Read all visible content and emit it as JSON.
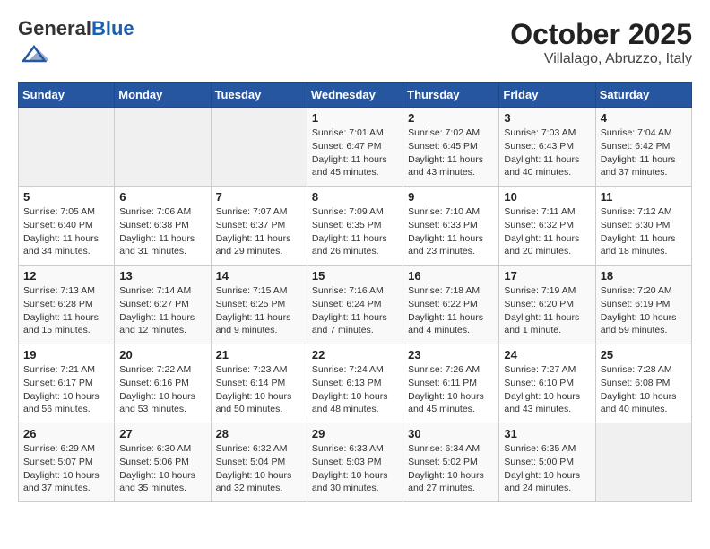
{
  "header": {
    "logo_general": "General",
    "logo_blue": "Blue",
    "month": "October 2025",
    "location": "Villalago, Abruzzo, Italy"
  },
  "weekdays": [
    "Sunday",
    "Monday",
    "Tuesday",
    "Wednesday",
    "Thursday",
    "Friday",
    "Saturday"
  ],
  "weeks": [
    [
      {
        "day": "",
        "info": ""
      },
      {
        "day": "",
        "info": ""
      },
      {
        "day": "",
        "info": ""
      },
      {
        "day": "1",
        "info": "Sunrise: 7:01 AM\nSunset: 6:47 PM\nDaylight: 11 hours and 45 minutes."
      },
      {
        "day": "2",
        "info": "Sunrise: 7:02 AM\nSunset: 6:45 PM\nDaylight: 11 hours and 43 minutes."
      },
      {
        "day": "3",
        "info": "Sunrise: 7:03 AM\nSunset: 6:43 PM\nDaylight: 11 hours and 40 minutes."
      },
      {
        "day": "4",
        "info": "Sunrise: 7:04 AM\nSunset: 6:42 PM\nDaylight: 11 hours and 37 minutes."
      }
    ],
    [
      {
        "day": "5",
        "info": "Sunrise: 7:05 AM\nSunset: 6:40 PM\nDaylight: 11 hours and 34 minutes."
      },
      {
        "day": "6",
        "info": "Sunrise: 7:06 AM\nSunset: 6:38 PM\nDaylight: 11 hours and 31 minutes."
      },
      {
        "day": "7",
        "info": "Sunrise: 7:07 AM\nSunset: 6:37 PM\nDaylight: 11 hours and 29 minutes."
      },
      {
        "day": "8",
        "info": "Sunrise: 7:09 AM\nSunset: 6:35 PM\nDaylight: 11 hours and 26 minutes."
      },
      {
        "day": "9",
        "info": "Sunrise: 7:10 AM\nSunset: 6:33 PM\nDaylight: 11 hours and 23 minutes."
      },
      {
        "day": "10",
        "info": "Sunrise: 7:11 AM\nSunset: 6:32 PM\nDaylight: 11 hours and 20 minutes."
      },
      {
        "day": "11",
        "info": "Sunrise: 7:12 AM\nSunset: 6:30 PM\nDaylight: 11 hours and 18 minutes."
      }
    ],
    [
      {
        "day": "12",
        "info": "Sunrise: 7:13 AM\nSunset: 6:28 PM\nDaylight: 11 hours and 15 minutes."
      },
      {
        "day": "13",
        "info": "Sunrise: 7:14 AM\nSunset: 6:27 PM\nDaylight: 11 hours and 12 minutes."
      },
      {
        "day": "14",
        "info": "Sunrise: 7:15 AM\nSunset: 6:25 PM\nDaylight: 11 hours and 9 minutes."
      },
      {
        "day": "15",
        "info": "Sunrise: 7:16 AM\nSunset: 6:24 PM\nDaylight: 11 hours and 7 minutes."
      },
      {
        "day": "16",
        "info": "Sunrise: 7:18 AM\nSunset: 6:22 PM\nDaylight: 11 hours and 4 minutes."
      },
      {
        "day": "17",
        "info": "Sunrise: 7:19 AM\nSunset: 6:20 PM\nDaylight: 11 hours and 1 minute."
      },
      {
        "day": "18",
        "info": "Sunrise: 7:20 AM\nSunset: 6:19 PM\nDaylight: 10 hours and 59 minutes."
      }
    ],
    [
      {
        "day": "19",
        "info": "Sunrise: 7:21 AM\nSunset: 6:17 PM\nDaylight: 10 hours and 56 minutes."
      },
      {
        "day": "20",
        "info": "Sunrise: 7:22 AM\nSunset: 6:16 PM\nDaylight: 10 hours and 53 minutes."
      },
      {
        "day": "21",
        "info": "Sunrise: 7:23 AM\nSunset: 6:14 PM\nDaylight: 10 hours and 50 minutes."
      },
      {
        "day": "22",
        "info": "Sunrise: 7:24 AM\nSunset: 6:13 PM\nDaylight: 10 hours and 48 minutes."
      },
      {
        "day": "23",
        "info": "Sunrise: 7:26 AM\nSunset: 6:11 PM\nDaylight: 10 hours and 45 minutes."
      },
      {
        "day": "24",
        "info": "Sunrise: 7:27 AM\nSunset: 6:10 PM\nDaylight: 10 hours and 43 minutes."
      },
      {
        "day": "25",
        "info": "Sunrise: 7:28 AM\nSunset: 6:08 PM\nDaylight: 10 hours and 40 minutes."
      }
    ],
    [
      {
        "day": "26",
        "info": "Sunrise: 6:29 AM\nSunset: 5:07 PM\nDaylight: 10 hours and 37 minutes."
      },
      {
        "day": "27",
        "info": "Sunrise: 6:30 AM\nSunset: 5:06 PM\nDaylight: 10 hours and 35 minutes."
      },
      {
        "day": "28",
        "info": "Sunrise: 6:32 AM\nSunset: 5:04 PM\nDaylight: 10 hours and 32 minutes."
      },
      {
        "day": "29",
        "info": "Sunrise: 6:33 AM\nSunset: 5:03 PM\nDaylight: 10 hours and 30 minutes."
      },
      {
        "day": "30",
        "info": "Sunrise: 6:34 AM\nSunset: 5:02 PM\nDaylight: 10 hours and 27 minutes."
      },
      {
        "day": "31",
        "info": "Sunrise: 6:35 AM\nSunset: 5:00 PM\nDaylight: 10 hours and 24 minutes."
      },
      {
        "day": "",
        "info": ""
      }
    ]
  ]
}
